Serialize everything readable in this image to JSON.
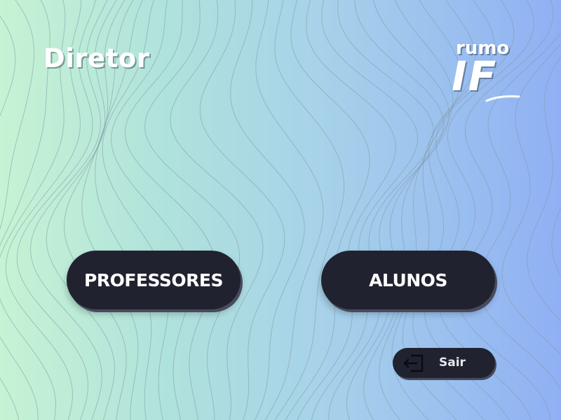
{
  "header": {
    "title": "Diretor"
  },
  "logo": {
    "top_text": "rumo",
    "bottom_text": "IF"
  },
  "main": {
    "professores_label": "PROFESSORES",
    "alunos_label": "ALUNOS"
  },
  "footer": {
    "sair_label": "Sair",
    "sair_icon": "logout-icon"
  },
  "colors": {
    "button_bg": "#20232f",
    "text_light": "#ffffff",
    "gradient_left": "#c6f3d4",
    "gradient_right": "#8fb0f4"
  }
}
